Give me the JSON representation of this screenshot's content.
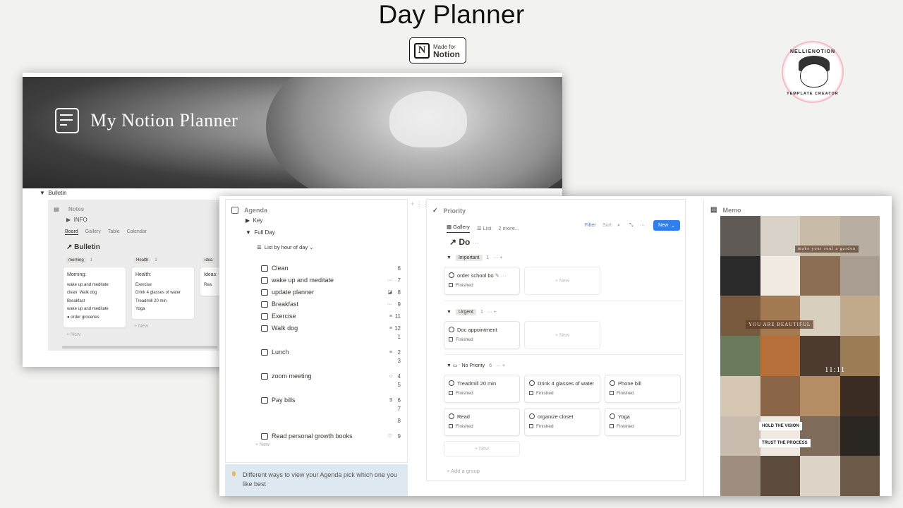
{
  "page_title": "Day Planner",
  "badge": {
    "line1": "Made for",
    "line2": "Notion",
    "logo_letter": "N"
  },
  "stamp": {
    "top_text": "NELLIENOTION",
    "bottom_text": "TEMPLATE CREATOR"
  },
  "back_window": {
    "cover_title": "My Notion Planner",
    "bulletin_toggle": "Bulletin",
    "notes_heading": "Notes",
    "info_toggle": "INFO",
    "tabs": [
      "Board",
      "Gallery",
      "Table",
      "Calendar"
    ],
    "bulletin_title": "Bulletin",
    "columns": [
      {
        "name": "morning",
        "count": "1",
        "card_title": "Morning:",
        "items": [
          "wake up and meditate",
          "clean",
          "Walk dog",
          "Breakfast",
          "wake up and meditate",
          "order groceries"
        ]
      },
      {
        "name": "Health",
        "count": "1",
        "card_title": "Health:",
        "items": [
          "Exercise",
          "Drink 4 glasses of water",
          "Treadmill 20 min",
          "Yoga"
        ]
      },
      {
        "name": "idea",
        "count": "",
        "card_title": "Ideas:",
        "items": [
          "Rea"
        ]
      }
    ],
    "new_label": "+ New"
  },
  "agenda": {
    "title": "Agenda",
    "key_toggle": "Key",
    "fullday_toggle": "Full Day",
    "view_label": "List by hour of day",
    "rows": [
      {
        "label": "Clean",
        "num": "6",
        "mark": ""
      },
      {
        "label": "wake up and meditate",
        "num": "7",
        "mark": "···"
      },
      {
        "label": "update planner",
        "num": "8",
        "mark": "◪"
      },
      {
        "label": "Breakfast",
        "num": "9",
        "mark": "···"
      },
      {
        "label": "Exercise",
        "num": "11",
        "mark": "≡"
      },
      {
        "label": "Walk dog",
        "num": "12",
        "mark": "≡"
      },
      {
        "label": "",
        "num": "1",
        "mark": ""
      },
      {
        "label": "Lunch",
        "num": "2",
        "mark": "≡"
      },
      {
        "label": "",
        "num": "3",
        "mark": ""
      },
      {
        "label": "zoom meeting",
        "num": "4",
        "mark": "○"
      },
      {
        "label": "",
        "num": "5",
        "mark": ""
      },
      {
        "label": "Pay bills",
        "num": "6",
        "mark": "$"
      },
      {
        "label": "",
        "num": "7",
        "mark": ""
      },
      {
        "label": "",
        "num": "8",
        "mark": ""
      },
      {
        "label": "Read personal growth books",
        "num": "9",
        "mark": "♡"
      }
    ],
    "new_label": "+ New",
    "tip": "Different ways to view your Agenda pick which one you like best"
  },
  "priority": {
    "title": "Priority",
    "tabs": [
      "Gallery",
      "List",
      "2 more..."
    ],
    "filter": "Filter",
    "sort": "Sort",
    "new_button": "New",
    "board_title": "Do",
    "groups": [
      {
        "name": "Important",
        "count": "1",
        "cards": [
          {
            "title": "order school bo",
            "status": "Finished"
          }
        ]
      },
      {
        "name": "Urgent",
        "count": "1",
        "cards": [
          {
            "title": "Doc appointment",
            "status": "Finished"
          }
        ]
      },
      {
        "name": "No Priority",
        "count": "6",
        "cards": [
          {
            "title": "Treadmill 20 min",
            "status": "Finished"
          },
          {
            "title": "Drink 4 glasses of water",
            "status": "Finished"
          },
          {
            "title": "Phone bill",
            "status": "Finished"
          },
          {
            "title": "Read",
            "status": "Finished"
          },
          {
            "title": "organize closet",
            "status": "Finished"
          },
          {
            "title": "Yoga",
            "status": "Finished"
          }
        ]
      }
    ],
    "new_card": "+ New",
    "add_group": "+ Add a group"
  },
  "memo": {
    "title": "Memo",
    "labels": [
      "make your soul a garden",
      "YOU ARE BEAUTIFUL",
      "11:11",
      "HOLD THE VISION",
      "TRUST THE PROCESS"
    ]
  },
  "colors": {
    "accent": "#2f80ed",
    "tip_bg": "#dde8f1"
  }
}
